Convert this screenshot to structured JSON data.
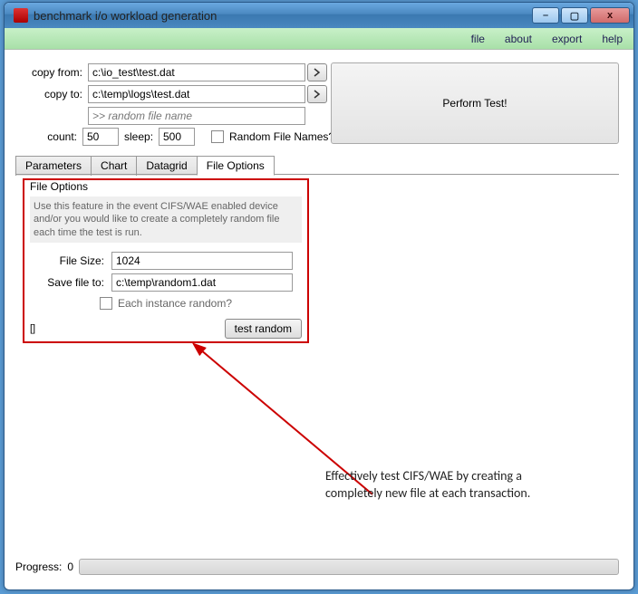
{
  "window": {
    "title": "benchmark i/o workload generation"
  },
  "menubar": {
    "file": "file",
    "about": "about",
    "export": "export",
    "help": "help"
  },
  "form": {
    "copy_from_label": "copy from:",
    "copy_from_value": "c:\\io_test\\test.dat",
    "copy_to_label": "copy to:",
    "copy_to_value": "c:\\temp\\logs\\test.dat",
    "random_name_placeholder": ">> random file name",
    "count_label": "count:",
    "count_value": "50",
    "sleep_label": "sleep:",
    "sleep_value": "500",
    "random_filenames_label": "Random File Names?"
  },
  "perform_button": "Perform Test!",
  "tabs": {
    "parameters": "Parameters",
    "chart": "Chart",
    "datagrid": "Datagrid",
    "file_options": "File Options"
  },
  "file_options": {
    "group_title": "File Options",
    "description": "Use this feature in the event CIFS/WAE enabled device and/or you would like to create a completely random file each time the test is run.",
    "file_size_label": "File Size:",
    "file_size_value": "1024",
    "save_file_label": "Save file to:",
    "save_file_value": "c:\\temp\\random1.dat",
    "each_instance_label": "Each instance random?",
    "status": "[]",
    "test_random_button": "test random"
  },
  "annotation": "Effectively test CIFS/WAE by creating a completely new file at each transaction.",
  "progress": {
    "label": "Progress:",
    "value": "0"
  }
}
